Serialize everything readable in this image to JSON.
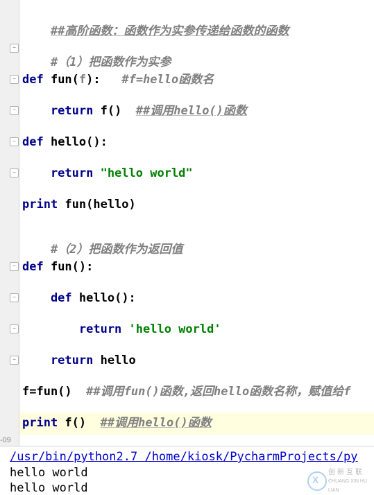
{
  "editor": {
    "l1": "##高阶函数：函数作为实参传递给函数的函数",
    "l2": "#（1）把函数作为实参",
    "l3a": "def ",
    "l3b": "fun",
    "l3c": "(",
    "l3d": "f",
    "l3e": "):   ",
    "l3f": "#f=hello函数名",
    "l4a": "    return ",
    "l4b": "f()  ",
    "l4c": "##调用hello()函数",
    "l5a": "def ",
    "l5b": "hello",
    "l5c": "():",
    "l6a": "    return ",
    "l6b": "\"hello world\"",
    "l7a": "print ",
    "l7b": "fun(hello)",
    "l8": "#（2）把函数作为返回值",
    "l9a": "def ",
    "l9b": "fun",
    "l9c": "():",
    "l10a": "    def ",
    "l10b": "hello",
    "l10c": "():",
    "l11a": "        return ",
    "l11b": "'hello world'",
    "l12a": "    return ",
    "l12b": "hello",
    "l13a": "f=fun()  ",
    "l13b": "##调用fun()函数,返回hello函数名称，赋值给f",
    "l14a": "print ",
    "l14b": "f()  ",
    "l14c": "##调用hello()函数"
  },
  "sep_label": "-09",
  "output": {
    "path": "/usr/bin/python2.7 /home/kiosk/PycharmProjects/py",
    "line2": "hello world",
    "line3": "hello world"
  },
  "watermark": {
    "line1": "创新互联",
    "line2": "CHUANG XIN HU LIAN"
  }
}
